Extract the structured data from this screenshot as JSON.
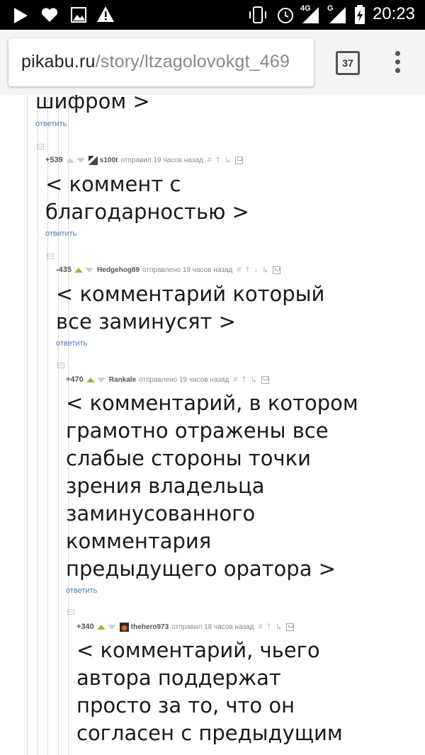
{
  "status_bar": {
    "time": "20:23",
    "network_label": "4G",
    "network_label_2": "G",
    "icons": [
      "play-icon",
      "heart-icon",
      "image-icon",
      "warning-icon",
      "vibrate-icon",
      "alarm-icon",
      "signal-icon",
      "signal-icon-2",
      "battery-icon"
    ]
  },
  "browser": {
    "url_domain": "pikabu.ru",
    "url_path": "/story/ltzagolovokgt_469",
    "tab_count": "37"
  },
  "comments": [
    {
      "rating": "",
      "author": "",
      "time": "",
      "lines": [
        "шифром >"
      ],
      "reply": "ответить"
    },
    {
      "rating": "+539",
      "author": "s100t",
      "time": "отправил 19 часов назад",
      "upvoted": false,
      "lines": [
        "< коммент с",
        "благодарностью >"
      ],
      "reply": "ответить"
    },
    {
      "rating": "-435",
      "author": "Hedgehog89",
      "time": "отправлено 19 часов назад",
      "upvoted": true,
      "lines": [
        "< комментарий который",
        "все заминусят >"
      ],
      "reply": "ответить"
    },
    {
      "rating": "+470",
      "author": "Rankale",
      "time": "отправлено 19 часов назад",
      "upvoted": true,
      "lines": [
        "< комментарий, в котором",
        "грамотно отражены все",
        "слабые стороны точки",
        "зрения владельца",
        "заминусованного",
        "комментария",
        "предыдущего оратора >"
      ],
      "reply": "ответить"
    },
    {
      "rating": "+340",
      "author": "thehero973",
      "time": "отправил 18 часов назад",
      "upvoted": true,
      "lines": [
        "< комментарий, чьего",
        "автора поддержат",
        "просто за то, что он",
        "согласен с предыдущим"
      ],
      "reply": ""
    }
  ],
  "comment_actions": {
    "link": "#",
    "pin": "†",
    "down": "↓",
    "reply_arrow": "↳"
  },
  "colors": {
    "upvote_active": "#8ac43f",
    "link": "#4a7db3",
    "status_bar": "#000000"
  }
}
